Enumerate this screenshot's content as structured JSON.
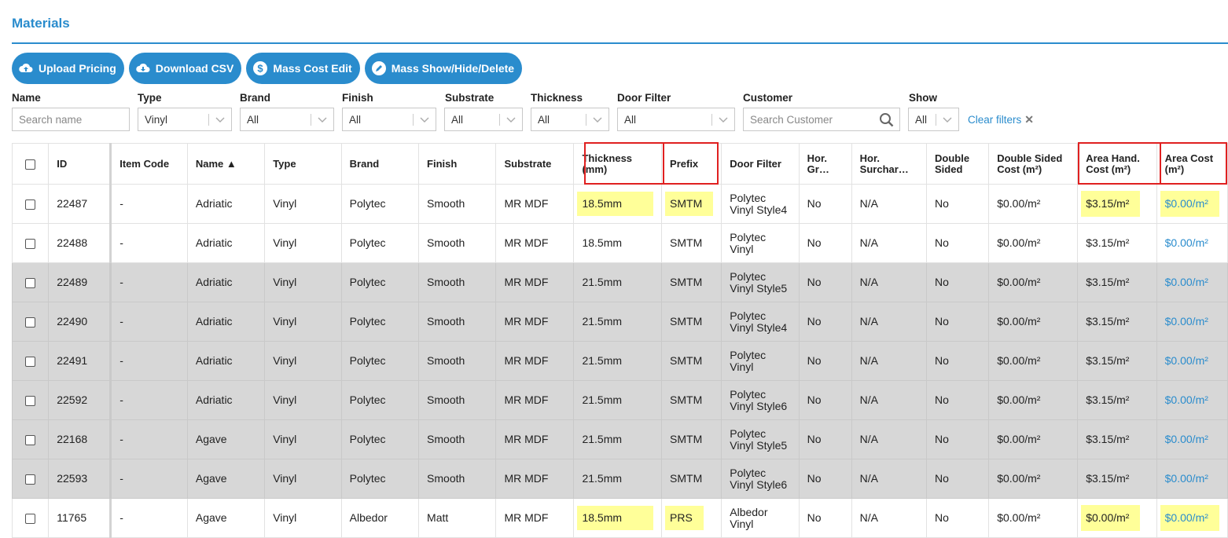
{
  "page": {
    "title": "Materials"
  },
  "toolbar": {
    "buttons": [
      {
        "label": "Upload Pricing",
        "icon": "cloud-upload-icon"
      },
      {
        "label": "Download CSV",
        "icon": "cloud-download-icon"
      },
      {
        "label": "Mass Cost Edit",
        "icon": "dollar-icon"
      },
      {
        "label": "Mass Show/Hide/Delete",
        "icon": "pencil-icon"
      }
    ]
  },
  "filters": {
    "name": {
      "label": "Name",
      "placeholder": "Search name"
    },
    "type": {
      "label": "Type",
      "value": "Vinyl"
    },
    "brand": {
      "label": "Brand",
      "value": "All"
    },
    "finish": {
      "label": "Finish",
      "value": "All"
    },
    "substrate": {
      "label": "Substrate",
      "value": "All"
    },
    "thickness": {
      "label": "Thickness",
      "value": "All"
    },
    "door_filter": {
      "label": "Door Filter",
      "value": "All"
    },
    "customer": {
      "label": "Customer",
      "placeholder": "Search Customer"
    },
    "show": {
      "label": "Show",
      "value": "All"
    },
    "clear_label": "Clear filters"
  },
  "table": {
    "headers": {
      "id": "ID",
      "item_code": "Item Code",
      "name": "Name ▲",
      "type": "Type",
      "brand": "Brand",
      "finish": "Finish",
      "substrate": "Substrate",
      "thickness": "Thickness (mm)",
      "prefix": "Prefix",
      "door_filter": "Door Filter",
      "hor_gr": "Hor. Gr…",
      "hor_surcharge": "Hor. Surchar…",
      "double_sided": "Double Sided",
      "double_sided_cost": "Double Sided Cost (m²)",
      "area_hand_cost": "Area Hand. Cost (m²)",
      "area_cost": "Area Cost (m²)"
    },
    "rows": [
      {
        "id": "22487",
        "item_code": "-",
        "name": "Adriatic",
        "type": "Vinyl",
        "brand": "Polytec",
        "finish": "Smooth",
        "substrate": "MR MDF",
        "thickness": "18.5mm",
        "prefix": "SMTM",
        "door_filter": "Polytec Vinyl Style4",
        "hor_gr": "No",
        "hor_surcharge": "N/A",
        "double_sided": "No",
        "double_sided_cost": "$0.00/m²",
        "area_hand_cost": "$3.15/m²",
        "area_cost": "$0.00/m²"
      },
      {
        "id": "22488",
        "item_code": "-",
        "name": "Adriatic",
        "type": "Vinyl",
        "brand": "Polytec",
        "finish": "Smooth",
        "substrate": "MR MDF",
        "thickness": "18.5mm",
        "prefix": "SMTM",
        "door_filter": "Polytec Vinyl",
        "hor_gr": "No",
        "hor_surcharge": "N/A",
        "double_sided": "No",
        "double_sided_cost": "$0.00/m²",
        "area_hand_cost": "$3.15/m²",
        "area_cost": "$0.00/m²"
      },
      {
        "id": "22489",
        "item_code": "-",
        "name": "Adriatic",
        "type": "Vinyl",
        "brand": "Polytec",
        "finish": "Smooth",
        "substrate": "MR MDF",
        "thickness": "21.5mm",
        "prefix": "SMTM",
        "door_filter": "Polytec Vinyl Style5",
        "hor_gr": "No",
        "hor_surcharge": "N/A",
        "double_sided": "No",
        "double_sided_cost": "$0.00/m²",
        "area_hand_cost": "$3.15/m²",
        "area_cost": "$0.00/m²"
      },
      {
        "id": "22490",
        "item_code": "-",
        "name": "Adriatic",
        "type": "Vinyl",
        "brand": "Polytec",
        "finish": "Smooth",
        "substrate": "MR MDF",
        "thickness": "21.5mm",
        "prefix": "SMTM",
        "door_filter": "Polytec Vinyl Style4",
        "hor_gr": "No",
        "hor_surcharge": "N/A",
        "double_sided": "No",
        "double_sided_cost": "$0.00/m²",
        "area_hand_cost": "$3.15/m²",
        "area_cost": "$0.00/m²"
      },
      {
        "id": "22491",
        "item_code": "-",
        "name": "Adriatic",
        "type": "Vinyl",
        "brand": "Polytec",
        "finish": "Smooth",
        "substrate": "MR MDF",
        "thickness": "21.5mm",
        "prefix": "SMTM",
        "door_filter": "Polytec Vinyl",
        "hor_gr": "No",
        "hor_surcharge": "N/A",
        "double_sided": "No",
        "double_sided_cost": "$0.00/m²",
        "area_hand_cost": "$3.15/m²",
        "area_cost": "$0.00/m²"
      },
      {
        "id": "22592",
        "item_code": "-",
        "name": "Adriatic",
        "type": "Vinyl",
        "brand": "Polytec",
        "finish": "Smooth",
        "substrate": "MR MDF",
        "thickness": "21.5mm",
        "prefix": "SMTM",
        "door_filter": "Polytec Vinyl Style6",
        "hor_gr": "No",
        "hor_surcharge": "N/A",
        "double_sided": "No",
        "double_sided_cost": "$0.00/m²",
        "area_hand_cost": "$3.15/m²",
        "area_cost": "$0.00/m²"
      },
      {
        "id": "22168",
        "item_code": "-",
        "name": "Agave",
        "type": "Vinyl",
        "brand": "Polytec",
        "finish": "Smooth",
        "substrate": "MR MDF",
        "thickness": "21.5mm",
        "prefix": "SMTM",
        "door_filter": "Polytec Vinyl Style5",
        "hor_gr": "No",
        "hor_surcharge": "N/A",
        "double_sided": "No",
        "double_sided_cost": "$0.00/m²",
        "area_hand_cost": "$3.15/m²",
        "area_cost": "$0.00/m²"
      },
      {
        "id": "22593",
        "item_code": "-",
        "name": "Agave",
        "type": "Vinyl",
        "brand": "Polytec",
        "finish": "Smooth",
        "substrate": "MR MDF",
        "thickness": "21.5mm",
        "prefix": "SMTM",
        "door_filter": "Polytec Vinyl Style6",
        "hor_gr": "No",
        "hor_surcharge": "N/A",
        "double_sided": "No",
        "double_sided_cost": "$0.00/m²",
        "area_hand_cost": "$3.15/m²",
        "area_cost": "$0.00/m²"
      },
      {
        "id": "11765",
        "item_code": "-",
        "name": "Agave",
        "type": "Vinyl",
        "brand": "Albedor",
        "finish": "Matt",
        "substrate": "MR MDF",
        "thickness": "18.5mm",
        "prefix": "PRS",
        "door_filter": "Albedor Vinyl",
        "hor_gr": "No",
        "hor_surcharge": "N/A",
        "double_sided": "No",
        "double_sided_cost": "$0.00/m²",
        "area_hand_cost": "$0.00/m²",
        "area_cost": "$0.00/m²"
      }
    ]
  },
  "colors": {
    "accent": "#2a8ccd",
    "row_grey": "#d7d7d7",
    "highlight": "#ffff99",
    "annotation_red": "#e02020"
  }
}
